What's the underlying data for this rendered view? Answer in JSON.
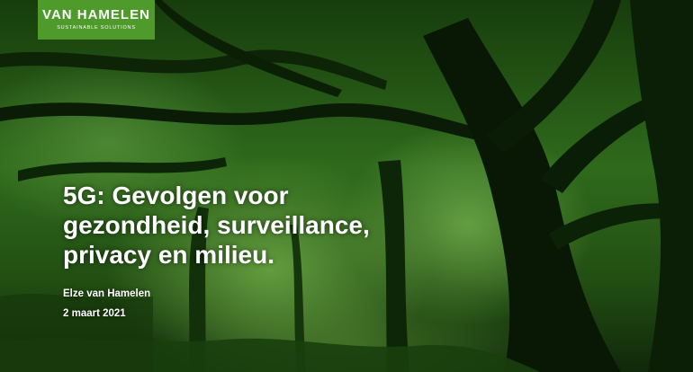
{
  "logo": {
    "name": "VAN HAMELEN",
    "tagline": "SUSTAINABLE SOLUTIONS"
  },
  "title_lines": [
    "5G: Gevolgen voor",
    "gezondheid, surveillance,",
    "privacy en milieu."
  ],
  "author": "Elze van Hamelen",
  "date": "2 maart 2021",
  "colors": {
    "logo_bg": "#4e9a2a",
    "photo_tint": "#2f6a1c",
    "text": "#ffffff"
  }
}
